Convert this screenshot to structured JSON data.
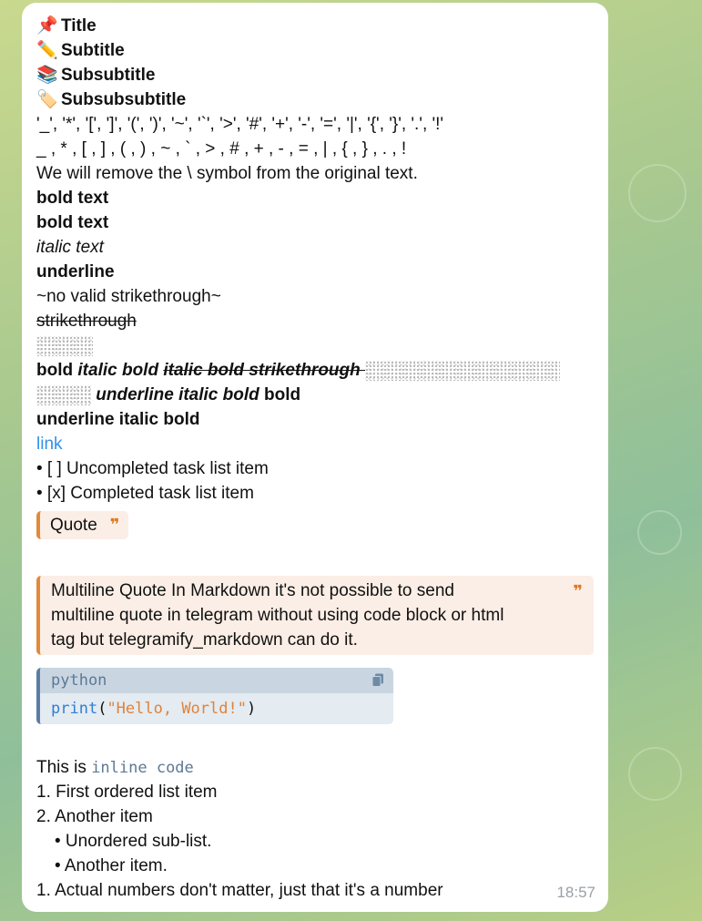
{
  "headings": {
    "title": {
      "emoji": "📌",
      "text": "Title"
    },
    "subtitle": {
      "emoji": "✏️",
      "text": "Subtitle"
    },
    "subsubtitle": {
      "emoji": "📚",
      "text": "Subsubtitle"
    },
    "subsubsubtitle": {
      "emoji": "🏷️",
      "text": "Subsubsubtitle"
    }
  },
  "escaped_list": "'_', '*', '[', ']', '(', ')', '~', '`', '>', '#', '+', '-', '=', '|', '{', '}', '.', '!'",
  "plain_chars": "_ , * , [ , ] , ( , ) , ~ , ` , > , # , + , - , = , | , { , } , . , !",
  "remove_note": "We will remove the \\ symbol from the original text.",
  "bold1": "bold text",
  "bold2": "bold text",
  "italic": "italic text",
  "underline": "underline",
  "no_strike": "~no valid strikethrough~",
  "strike": "strikethrough",
  "mixed": {
    "bold": "bold ",
    "italic_bold": "italic bold ",
    "italic_bold_strike": "italic bold strikethrough ",
    "underline_italic_bold": " underline italic bold",
    "trailing_bold": " bold"
  },
  "underline_italic_bold": "underline italic bold",
  "link": "link",
  "tasks": [
    "• [ ] Uncompleted task list item",
    "• [x] Completed task list item"
  ],
  "quote": {
    "text": "Quote",
    "mark": "❞"
  },
  "multiline_quote": {
    "lines": [
      "Multiline Quote In Markdown it's not possible to send",
      "multiline quote in telegram without using code block or html",
      "tag but telegramify_markdown can do it."
    ],
    "mark": "❞"
  },
  "code_block": {
    "language": "python",
    "fn": "print",
    "open": "(",
    "str": "\"Hello, World!\"",
    "close": ")"
  },
  "inline_code": {
    "prefix": "This is ",
    "code": "inline code"
  },
  "list": {
    "item1": "1. First ordered list item",
    "item2": "2. Another item",
    "sub1": "• Unordered sub-list.",
    "sub2": "• Another item.",
    "item3": "1. Actual numbers don't matter, just that it's a number"
  },
  "time": "18:57",
  "colors": {
    "accent": "#3390ec",
    "quote_border": "#e28a3c",
    "quote_bg": "#fbeee6",
    "code_border": "#5b7ea6"
  }
}
